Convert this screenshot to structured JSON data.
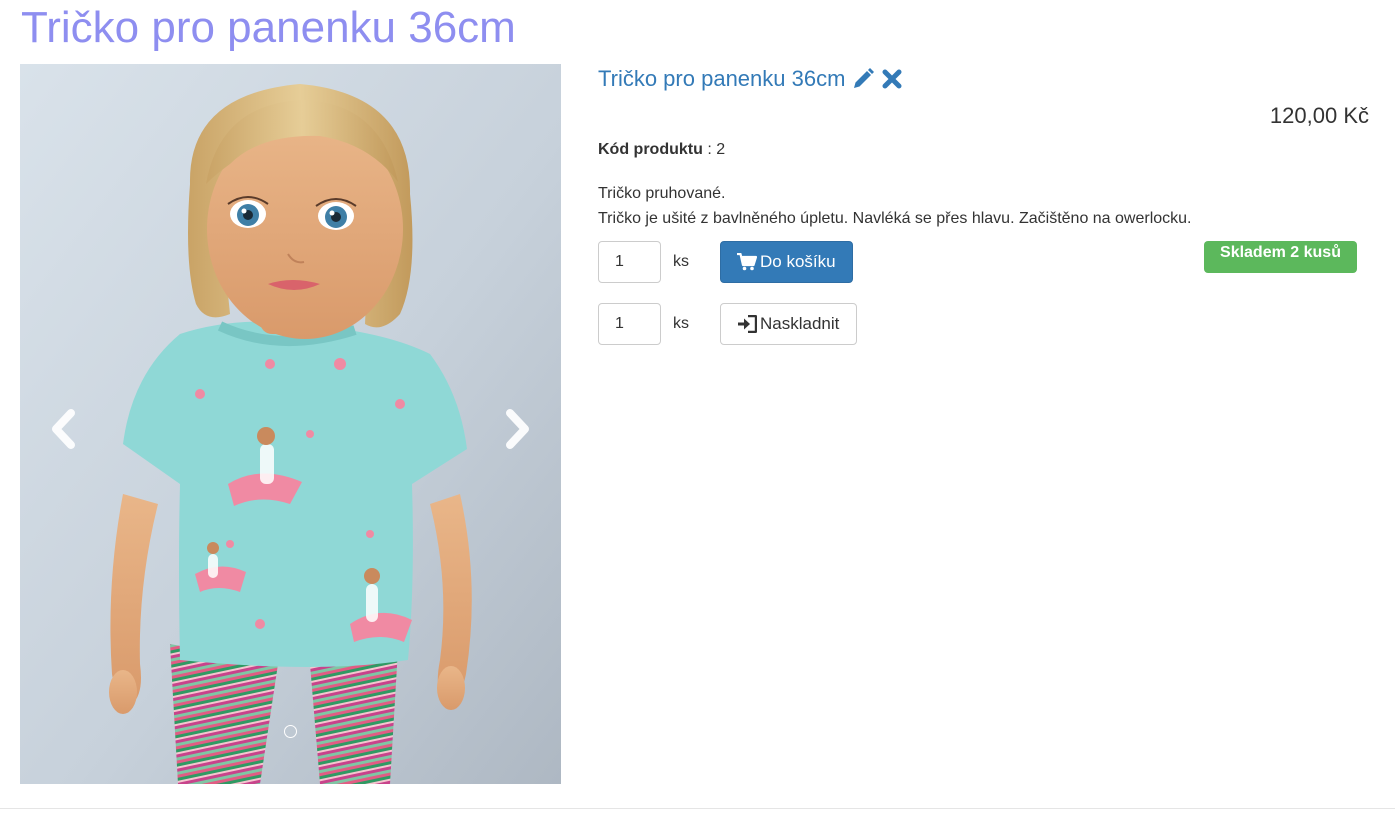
{
  "page": {
    "title": "Tričko pro panenku 36cm"
  },
  "carousel": {
    "image_alt": "Tričko pro panenku 36cm",
    "prev_icon": "chevron-left-icon",
    "next_icon": "chevron-right-icon",
    "indicator_count": 1
  },
  "product": {
    "name": "Tričko pro panenku 36cm",
    "edit_icon": "pencil-icon",
    "delete_icon": "close-icon",
    "price": "120,00 Kč",
    "code_label": "Kód produktu",
    "code_separator": " : ",
    "code_value": "2",
    "description_lines": [
      "Tričko pruhované.",
      "Tričko je ušité z bavlněného úpletu. Navléká se přes hlavu. Začištěno na owerlocku."
    ]
  },
  "cart_form": {
    "quantity": "1",
    "unit": "ks",
    "button_label": "Do košíku",
    "button_icon": "shopping-cart-icon"
  },
  "stock_form": {
    "quantity": "1",
    "unit": "ks",
    "button_label": "Naskladnit",
    "button_icon": "log-in-icon"
  },
  "stock_badge": {
    "label": "Skladem 2 kusů"
  },
  "colors": {
    "page_title": "#8e8ef0",
    "link": "#337ab7",
    "primary_button": "#337ab7",
    "badge_success": "#5cb85c",
    "text": "#333333"
  }
}
